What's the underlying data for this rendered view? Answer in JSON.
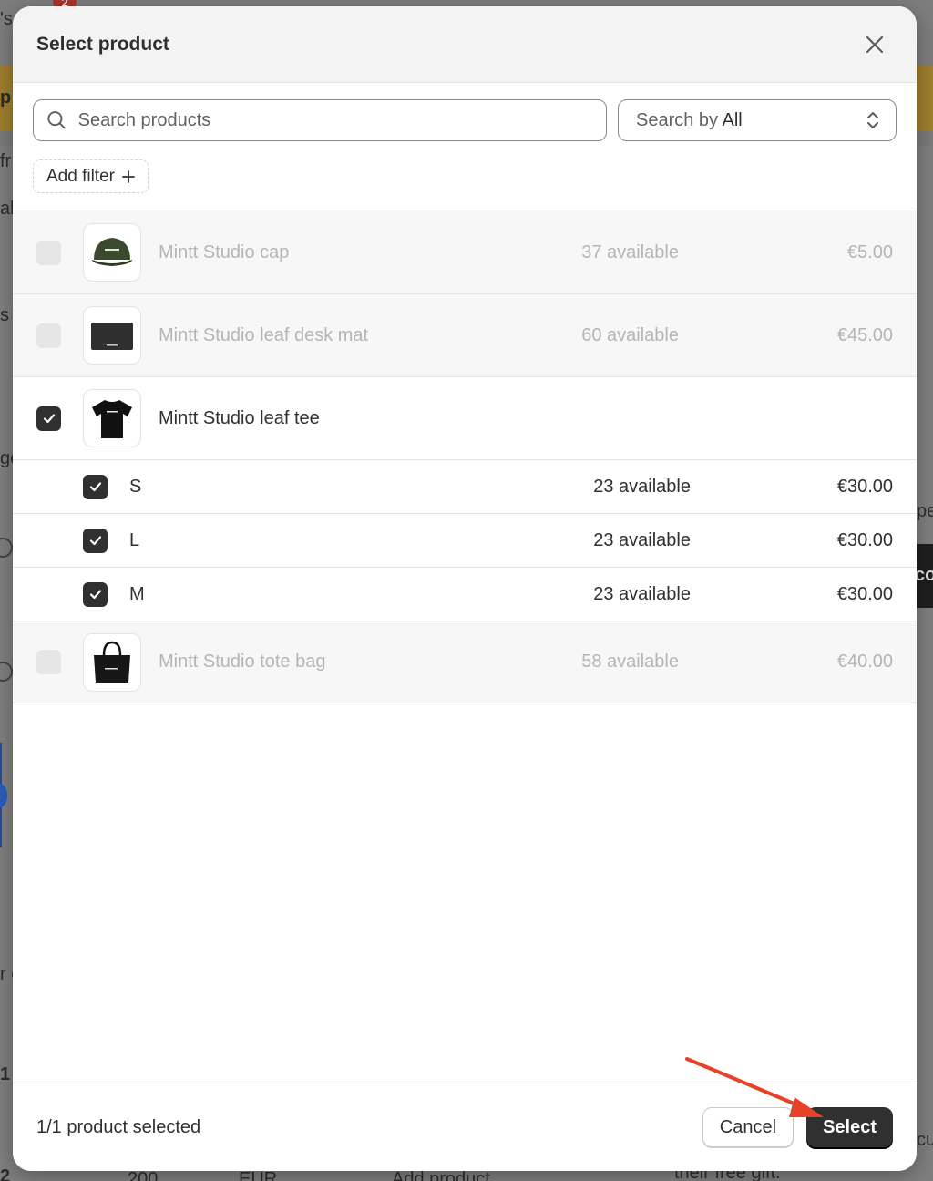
{
  "background": {
    "badge_count": "2",
    "snippets": [
      "'s",
      "p",
      "fr",
      "ab",
      "s",
      "ge",
      "pe",
      "co",
      "r e",
      "1",
      "2",
      "cu",
      "200",
      "EUR",
      "Add product",
      "their free gift."
    ]
  },
  "modal": {
    "title": "Select product",
    "close_icon": "close-icon"
  },
  "search": {
    "placeholder": "Search products",
    "value": "",
    "search_by_label": "Search by",
    "search_by_value": "All"
  },
  "filter": {
    "add_filter_label": "Add filter"
  },
  "products": [
    {
      "name": "Mintt Studio cap",
      "available": "37 available",
      "price": "€5.00",
      "checked": false,
      "disabled": true,
      "icon": "cap-thumbnail"
    },
    {
      "name": "Mintt Studio leaf desk mat",
      "available": "60 available",
      "price": "€45.00",
      "checked": false,
      "disabled": true,
      "icon": "desk-mat-thumbnail"
    },
    {
      "name": "Mintt Studio leaf tee",
      "available": "",
      "price": "",
      "checked": true,
      "disabled": false,
      "icon": "tee-thumbnail",
      "variants": [
        {
          "name": "S",
          "available": "23 available",
          "price": "€30.00",
          "checked": true
        },
        {
          "name": "L",
          "available": "23 available",
          "price": "€30.00",
          "checked": true
        },
        {
          "name": "M",
          "available": "23 available",
          "price": "€30.00",
          "checked": true
        }
      ]
    },
    {
      "name": "Mintt Studio tote bag",
      "available": "58 available",
      "price": "€40.00",
      "checked": false,
      "disabled": true,
      "icon": "tote-bag-thumbnail"
    }
  ],
  "footer": {
    "status": "1/1 product selected",
    "cancel_label": "Cancel",
    "select_label": "Select"
  },
  "colors": {
    "primary": "#303030",
    "annotation_arrow": "#e8412a",
    "disabled_text": "#b5b5b5"
  }
}
